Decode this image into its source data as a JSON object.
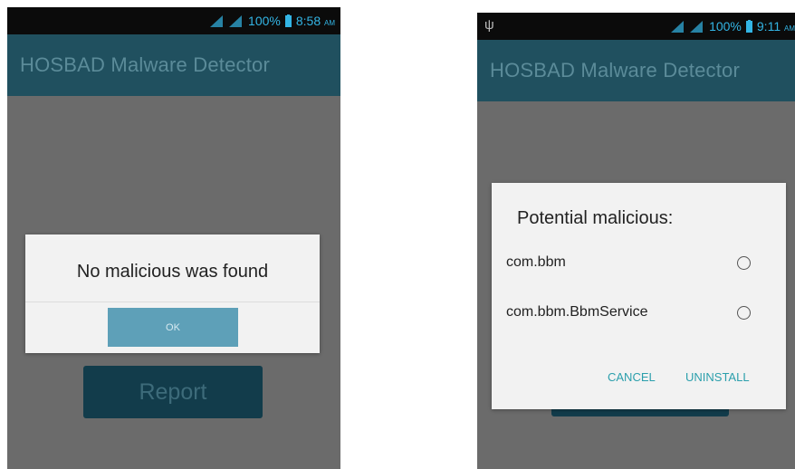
{
  "left_screen": {
    "status_bar": {
      "battery": "100%",
      "time": "8:58",
      "ampm": "AM"
    },
    "app_title": "HOSBAD Malware Detector",
    "dialog": {
      "message": "No malicious was found",
      "ok_label": "OK"
    },
    "report_button": "Report"
  },
  "right_screen": {
    "status_bar": {
      "battery": "100%",
      "time": "9:11",
      "ampm": "AM",
      "usb_icon": "usb-icon"
    },
    "app_title": "HOSBAD Malware Detector",
    "dialog": {
      "title": "Potential malicious:",
      "items": [
        {
          "label": "com.bbm"
        },
        {
          "label": "com.bbm.BbmService"
        }
      ],
      "cancel_label": "CANCEL",
      "uninstall_label": "UNINSTALL"
    }
  },
  "colors": {
    "accent": "#33b5e5",
    "appbar": "#20505f",
    "dialog_action": "#2b9fac",
    "ok_button": "#5ea0b8"
  }
}
